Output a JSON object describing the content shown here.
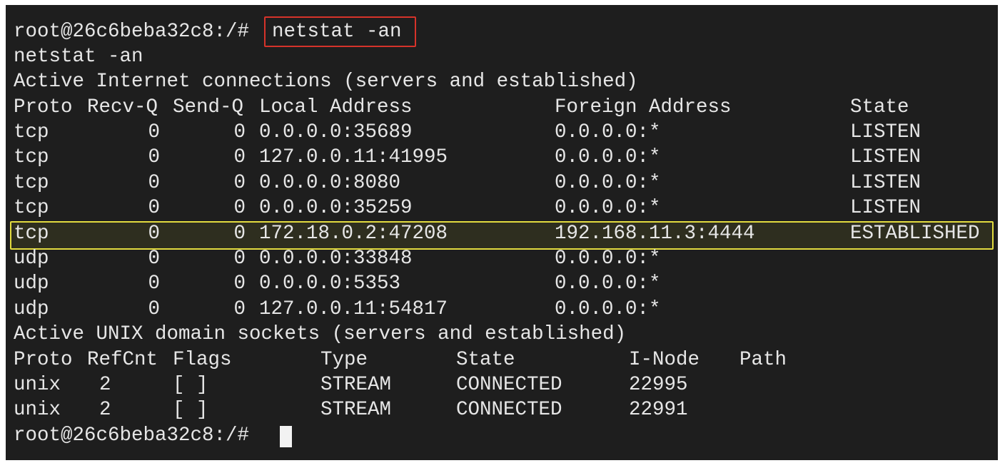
{
  "prompt": "root@26c6beba32c8:/#",
  "command": "netstat -an",
  "echo": "netstat -an",
  "inet_section_title": "Active Internet connections (servers and established)",
  "inet_headers": {
    "proto": "Proto",
    "recvq": "Recv-Q",
    "sendq": "Send-Q",
    "local": "Local Address",
    "foreign": "Foreign Address",
    "state": "State"
  },
  "inet_rows": [
    {
      "proto": "tcp",
      "recvq": "0",
      "sendq": "0",
      "local": "0.0.0.0:35689",
      "foreign": "0.0.0.0:*",
      "state": "LISTEN"
    },
    {
      "proto": "tcp",
      "recvq": "0",
      "sendq": "0",
      "local": "127.0.0.11:41995",
      "foreign": "0.0.0.0:*",
      "state": "LISTEN"
    },
    {
      "proto": "tcp",
      "recvq": "0",
      "sendq": "0",
      "local": "0.0.0.0:8080",
      "foreign": "0.0.0.0:*",
      "state": "LISTEN"
    },
    {
      "proto": "tcp",
      "recvq": "0",
      "sendq": "0",
      "local": "0.0.0.0:35259",
      "foreign": "0.0.0.0:*",
      "state": "LISTEN"
    },
    {
      "proto": "tcp",
      "recvq": "0",
      "sendq": "0",
      "local": "172.18.0.2:47208",
      "foreign": "192.168.11.3:4444",
      "state": "ESTABLISHED"
    },
    {
      "proto": "udp",
      "recvq": "0",
      "sendq": "0",
      "local": "0.0.0.0:33848",
      "foreign": "0.0.0.0:*",
      "state": ""
    },
    {
      "proto": "udp",
      "recvq": "0",
      "sendq": "0",
      "local": "0.0.0.0:5353",
      "foreign": "0.0.0.0:*",
      "state": ""
    },
    {
      "proto": "udp",
      "recvq": "0",
      "sendq": "0",
      "local": "127.0.0.11:54817",
      "foreign": "0.0.0.0:*",
      "state": ""
    }
  ],
  "unix_section_title": "Active UNIX domain sockets (servers and established)",
  "unix_headers": {
    "proto": "Proto",
    "refcnt": "RefCnt",
    "flags": "Flags",
    "type": "Type",
    "state": "State",
    "inode": "I-Node",
    "path": "Path"
  },
  "unix_rows": [
    {
      "proto": "unix",
      "refcnt": "2",
      "flags": "[ ]",
      "type": "STREAM",
      "state": "CONNECTED",
      "inode": "22995",
      "path": ""
    },
    {
      "proto": "unix",
      "refcnt": "2",
      "flags": "[ ]",
      "type": "STREAM",
      "state": "CONNECTED",
      "inode": "22991",
      "path": ""
    }
  ],
  "colors": {
    "background": "#1e1e1e",
    "text": "#e6e6e6",
    "command_highlight": "#d6332a",
    "row_highlight": "#e3dc3f"
  }
}
